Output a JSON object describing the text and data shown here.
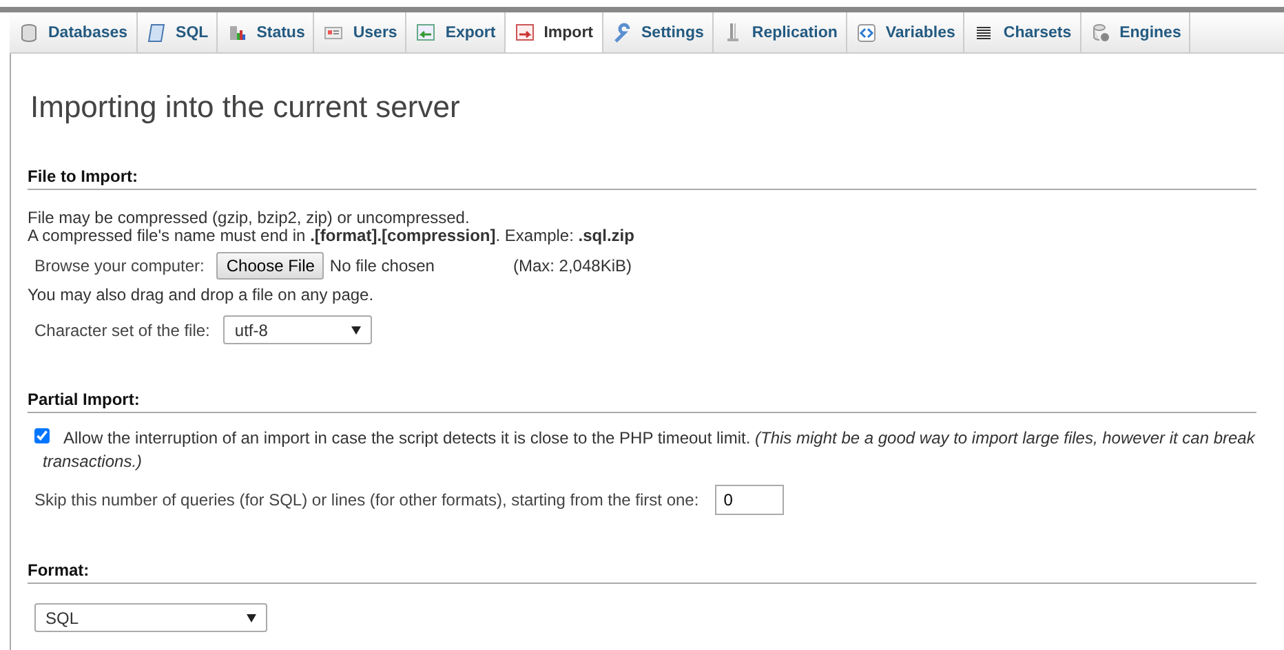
{
  "tabs": [
    {
      "label": "Databases",
      "selected": false
    },
    {
      "label": "SQL",
      "selected": false
    },
    {
      "label": "Status",
      "selected": false
    },
    {
      "label": "Users",
      "selected": false
    },
    {
      "label": "Export",
      "selected": false
    },
    {
      "label": "Import",
      "selected": true
    },
    {
      "label": "Settings",
      "selected": false
    },
    {
      "label": "Replication",
      "selected": false
    },
    {
      "label": "Variables",
      "selected": false
    },
    {
      "label": "Charsets",
      "selected": false
    },
    {
      "label": "Engines",
      "selected": false
    }
  ],
  "page_title": "Importing into the current server",
  "file_to_import": {
    "heading": "File to Import:",
    "note_1": "File may be compressed (gzip, bzip2, zip) or uncompressed.",
    "note_2": "A compressed file's name must end in **.[format].[compression]**. Example: **.sql.zip**",
    "browse_label": "Browse your computer:",
    "choose_button": "Choose File",
    "no_file": "No file chosen",
    "max_size": "(Max: 2,048KiB)",
    "drag_note": "You may also drag and drop a file on any page.",
    "charset_label": "Character set of the file:",
    "charset_value": "utf-8"
  },
  "partial_import": {
    "heading": "Partial Import:",
    "allow_interrupt": {
      "checked": true,
      "label": "Allow the interruption of an import in case the script detects it is close to the PHP timeout limit. *(This might be a good way to import large files, however it can break transactions.)*"
    },
    "skip_label": "Skip this number of queries (for SQL) or lines (for other formats), starting from the first one:",
    "skip_value": "0"
  },
  "format": {
    "heading": "Format:",
    "value": "SQL"
  }
}
